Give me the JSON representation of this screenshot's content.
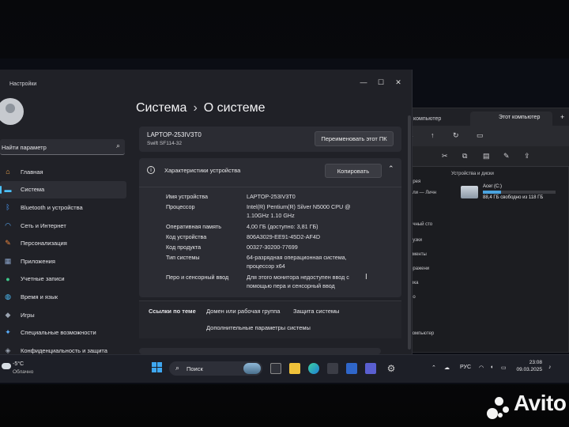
{
  "settings": {
    "window_title": "Настройки",
    "search_placeholder": "Найти параметр",
    "nav": [
      {
        "label": "Главная",
        "icon": "home-icon"
      },
      {
        "label": "Система",
        "icon": "system-icon"
      },
      {
        "label": "Bluetooth и устройства",
        "icon": "bluetooth-icon"
      },
      {
        "label": "Сеть и Интернет",
        "icon": "wifi-icon"
      },
      {
        "label": "Персонализация",
        "icon": "brush-icon"
      },
      {
        "label": "Приложения",
        "icon": "apps-icon"
      },
      {
        "label": "Учетные записи",
        "icon": "account-icon"
      },
      {
        "label": "Время и язык",
        "icon": "globe-icon"
      },
      {
        "label": "Игры",
        "icon": "gamepad-icon"
      },
      {
        "label": "Специальные возможности",
        "icon": "accessibility-icon"
      },
      {
        "label": "Конфиденциальность и защита",
        "icon": "shield-icon"
      }
    ],
    "breadcrumb": {
      "parent": "Система",
      "separator": "›",
      "current": "О системе"
    },
    "device": {
      "name": "LAPTOP-253IV3T0",
      "model": "Swift SF114-32",
      "rename_button": "Переименовать этот ПК"
    },
    "specs": {
      "title": "Характеристики устройства",
      "copy_button": "Копировать",
      "rows": [
        {
          "key": "Имя устройства",
          "value": "LAPTOP-253IV3T0"
        },
        {
          "key": "Процессор",
          "value": "Intel(R) Pentium(R) Silver N5000 CPU @ 1.10GHz 1.10 GHz"
        },
        {
          "key": "Оперативная память",
          "value": "4,00 ГБ (доступно: 3,81 ГБ)"
        },
        {
          "key": "Код устройства",
          "value": "806A3029-EE91-45D2-AF4D"
        },
        {
          "key": "Код продукта",
          "value": "00327-30200-77699"
        },
        {
          "key": "Тип системы",
          "value": "64-разрядная операционная система, процессор x64"
        },
        {
          "key": "Перо и сенсорный ввод",
          "value": "Для этого монитора недоступен ввод с помощью пера и сенсорный ввод"
        }
      ]
    },
    "related": {
      "label": "Ссылки по теме",
      "links": [
        "Домен или рабочая группа",
        "Защита системы",
        "Дополнительные параметры системы"
      ]
    }
  },
  "explorer": {
    "title": "компьютер",
    "tab": "Этот компьютер",
    "sidebar": [
      "ерея",
      "ели — Личн",
      "ичный сто",
      "рузки",
      "ументы",
      "бражени",
      "ыка",
      "ео",
      "компьютер"
    ],
    "section": "Устройства и диски",
    "drive": {
      "name": "Acer (C:)",
      "free": "88,4 ГБ свободно из 118 ГБ",
      "used_fraction": 0.25
    }
  },
  "taskbar": {
    "temp": "-5°C",
    "weather": "Облачно",
    "search": "Поиск",
    "lang": "РУС",
    "time": "23:08",
    "date": "09.03.2025"
  },
  "watermark": "Avito"
}
